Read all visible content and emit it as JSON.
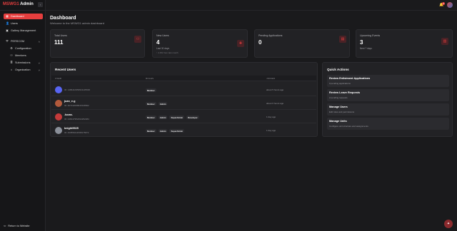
{
  "app": {
    "brand_prefix": "MSWG1",
    "brand_suffix": " Admin"
  },
  "sidebar": {
    "items": [
      {
        "label": "Dashboard",
        "icon": "dashboard-icon",
        "active": true
      },
      {
        "label": "Users",
        "icon": "users-icon"
      },
      {
        "label": "Gallery Management",
        "icon": "gallery-icon"
      },
      {
        "label": "PERSCOM",
        "icon": "shield-icon",
        "expandable": true
      },
      {
        "label": "Configuration",
        "icon": "gear-icon",
        "sub": true
      },
      {
        "label": "Members",
        "icon": "members-icon",
        "sub": true
      },
      {
        "label": "Submissions",
        "icon": "submissions-icon",
        "sub": true,
        "expandable": true
      },
      {
        "label": "Organization",
        "icon": "organization-icon",
        "sub": true,
        "expandable": true
      }
    ],
    "return_label": "Return to Website"
  },
  "topbar": {
    "notification_count": "3"
  },
  "page": {
    "title": "Dashboard",
    "subtitle": "Welcome to the MSWG1 admin dashboard"
  },
  "stats": [
    {
      "label": "Total Users",
      "value": "111",
      "meta1": "",
      "meta2": "",
      "icon": "users-icon"
    },
    {
      "label": "New Users",
      "value": "4",
      "meta1": "Last 30 days",
      "meta2": "↑ 4.0% from last month",
      "icon": "user-plus-icon"
    },
    {
      "label": "Pending Applications",
      "value": "0",
      "meta1": "",
      "meta2": "",
      "icon": "document-icon"
    },
    {
      "label": "Upcoming Events",
      "value": "3",
      "meta1": "Next 7 days",
      "meta2": "",
      "icon": "calendar-icon"
    }
  ],
  "recent_users": {
    "title": "Recent Users",
    "columns": [
      "USER",
      "ROLES",
      "JOINED"
    ],
    "rows": [
      {
        "name": "",
        "id": "ID: 1486410959521135930",
        "roles": [
          "Member"
        ],
        "joined": "about 5 hours ago",
        "avatar_color": "#5865f2"
      },
      {
        "name": "juan_e.g",
        "id": "ID: 307342068915318602",
        "roles": [
          "Member",
          "Admin"
        ],
        "joined": "about 6 hours ago",
        "avatar_color": "#b35a3c"
      },
      {
        "name": ".lucas.",
        "id": "ID: 248147952494252484",
        "roles": [
          "Member",
          "Admin",
          "SuperAdmin",
          "Developer"
        ],
        "joined": "1 day ago",
        "avatar_color": "#c43a3a"
      },
      {
        "name": "knight9925",
        "id": "ID: 263556411598175872",
        "roles": [
          "Member",
          "Admin",
          "SuperAdmin"
        ],
        "joined": "1 day ago",
        "avatar_color": "#8a8f99"
      }
    ]
  },
  "quick_actions": {
    "title": "Quick Actions",
    "items": [
      {
        "title": "Review Enlistment Applications",
        "desc": "0 pending applications"
      },
      {
        "title": "Review Leave Requests",
        "desc": "2 pending requests"
      },
      {
        "title": "Manage Users",
        "desc": "Edit roles and permissions"
      },
      {
        "title": "Manage Units",
        "desc": "Configure unit structure and assignments"
      }
    ]
  },
  "colors": {
    "accent": "#e53e3e",
    "background": "#1a1a1c",
    "card": "#222225"
  }
}
